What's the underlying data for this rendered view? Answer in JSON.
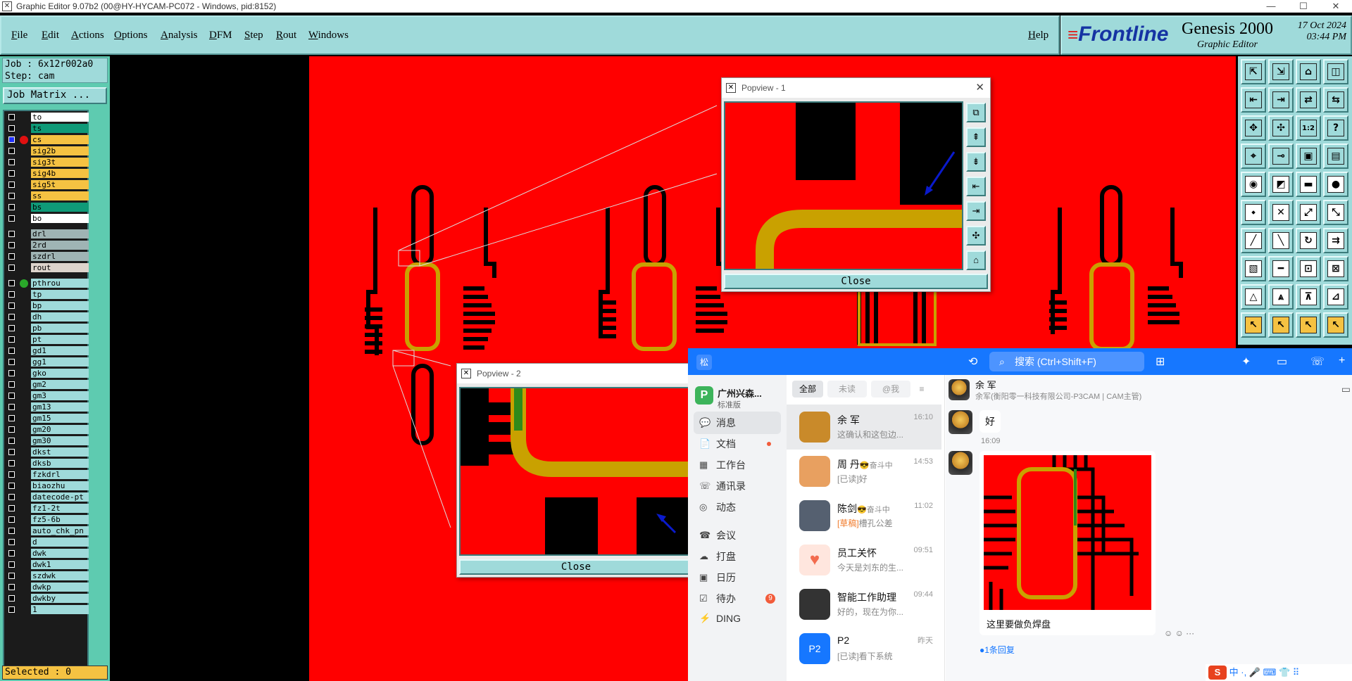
{
  "window": {
    "title": "Graphic Editor 9.07b2 (00@HY-HYCAM-PC072 - Windows, pid:8152)",
    "min": "—",
    "max": "☐",
    "close": "✕"
  },
  "menu": [
    "File",
    "Edit",
    "Actions",
    "Options",
    "Analysis",
    "DFM",
    "Step",
    "Rout",
    "Windows"
  ],
  "help": "Help",
  "logo": {
    "brand": "Frontline",
    "product": "Genesis 2000",
    "subtitle": "Graphic Editor",
    "date": "17 Oct 2024",
    "time": "03:44 PM"
  },
  "job": {
    "job_line": "Job : 6x12r002a0",
    "step_line": "Step: cam",
    "matrix_button": "Job Matrix ...",
    "selected": "Selected : 0"
  },
  "layers": [
    {
      "name": "to",
      "color": "#ffffff"
    },
    {
      "name": "ts",
      "color": "#0f9a78"
    },
    {
      "name": "cs",
      "color": "#f5c242",
      "checked": true,
      "dot": "#e01010"
    },
    {
      "name": "sig2b",
      "color": "#f5c242"
    },
    {
      "name": "sig3t",
      "color": "#f5c242"
    },
    {
      "name": "sig4b",
      "color": "#f5c242"
    },
    {
      "name": "sig5t",
      "color": "#f5c242"
    },
    {
      "name": "ss",
      "color": "#f5c242"
    },
    {
      "name": "bs",
      "color": "#0f9a78"
    },
    {
      "name": "bo",
      "color": "#ffffff"
    },
    {
      "name": "drl",
      "color": "#9fb4b4"
    },
    {
      "name": "2rd",
      "color": "#9fb4b4"
    },
    {
      "name": "szdrl",
      "color": "#9fb4b4"
    },
    {
      "name": "rout",
      "color": "#ddd4cc"
    },
    {
      "name": "pthrou",
      "color": "#9fdada",
      "dot": "#2aa82a"
    },
    {
      "name": "tp",
      "color": "#9fdada"
    },
    {
      "name": "bp",
      "color": "#9fdada"
    },
    {
      "name": "dh",
      "color": "#9fdada"
    },
    {
      "name": "pb",
      "color": "#9fdada"
    },
    {
      "name": "pt",
      "color": "#9fdada"
    },
    {
      "name": "gd1",
      "color": "#9fdada"
    },
    {
      "name": "gg1",
      "color": "#9fdada"
    },
    {
      "name": "gko",
      "color": "#9fdada"
    },
    {
      "name": "gm2",
      "color": "#9fdada"
    },
    {
      "name": "gm3",
      "color": "#9fdada"
    },
    {
      "name": "gm13",
      "color": "#9fdada"
    },
    {
      "name": "gm15",
      "color": "#9fdada"
    },
    {
      "name": "gm20",
      "color": "#9fdada"
    },
    {
      "name": "gm30",
      "color": "#9fdada"
    },
    {
      "name": "dkst",
      "color": "#9fdada"
    },
    {
      "name": "dksb",
      "color": "#9fdada"
    },
    {
      "name": "fzkdrl",
      "color": "#9fdada"
    },
    {
      "name": "biaozhu",
      "color": "#9fdada"
    },
    {
      "name": "datecode-pt",
      "color": "#9fdada"
    },
    {
      "name": "fz1-2t",
      "color": "#9fdada"
    },
    {
      "name": "fz5-6b",
      "color": "#9fdada"
    },
    {
      "name": "auto_chk_pn",
      "color": "#9fdada"
    },
    {
      "name": "d",
      "color": "#9fdada"
    },
    {
      "name": "dwk",
      "color": "#9fdada"
    },
    {
      "name": "dwk1",
      "color": "#9fdada"
    },
    {
      "name": "szdwk",
      "color": "#9fdada"
    },
    {
      "name": "dwkp",
      "color": "#9fdada"
    },
    {
      "name": "dwkby",
      "color": "#9fdada"
    },
    {
      "name": "1",
      "color": "#9fdada"
    }
  ],
  "popview1": {
    "title": "Popview - 1",
    "close": "Close"
  },
  "popview2": {
    "title": "Popview - 2",
    "close": "Close"
  },
  "dingtalk": {
    "logo_char": "松",
    "search": "搜索 (Ctrl+Shift+F)",
    "org_name": "广州兴森...",
    "org_type": "标准版",
    "nav": [
      {
        "label": "消息",
        "icon": "💬"
      },
      {
        "label": "文档",
        "icon": "📄",
        "dot": true
      },
      {
        "label": "工作台",
        "icon": "▦"
      },
      {
        "label": "通讯录",
        "icon": "☏"
      },
      {
        "label": "动态",
        "icon": "◎"
      },
      {
        "label": "会议",
        "icon": "☎"
      },
      {
        "label": "打盘",
        "icon": "☁"
      },
      {
        "label": "日历",
        "icon": "▣"
      },
      {
        "label": "待办",
        "icon": "☑",
        "badge": "9"
      },
      {
        "label": "DING",
        "icon": "⚡"
      }
    ],
    "tabs": [
      "全部",
      "未读",
      "@我"
    ],
    "conversations": [
      {
        "name": "余 军",
        "preview": "这确认和这包边...",
        "time": "16:10",
        "avatar": "#c98a2a"
      },
      {
        "name": "周 丹",
        "status": "😎奋斗中",
        "preview": "[已读]好",
        "time": "14:53",
        "avatar": "#e8a060"
      },
      {
        "name": "陈剑",
        "status": "😎奋斗中",
        "tag": "[草稿]",
        "preview": "槽孔公差",
        "time": "11:02",
        "avatar": "#556070"
      },
      {
        "name": "员工关怀",
        "preview": "今天是刘东的生...",
        "time": "09:51",
        "avatar": "#ffe6de"
      },
      {
        "name": "智能工作助理",
        "preview": "好的，现在为你...",
        "time": "09:44",
        "avatar": "#333"
      },
      {
        "name": "P2",
        "preview": "[已读]看下系统",
        "time": "昨天",
        "avatar": "#1677ff"
      }
    ],
    "chat": {
      "contact": "余 军",
      "contact_sub": "余军(衡阳零一科技有限公司-P3CAM | CAM主管)",
      "msg1": "好",
      "time": "16:09",
      "caption": "这里要做负焊盘",
      "reply": "1条回复"
    },
    "ime": "中 ·, 🎤 ⌨ 👕 ⠿"
  }
}
